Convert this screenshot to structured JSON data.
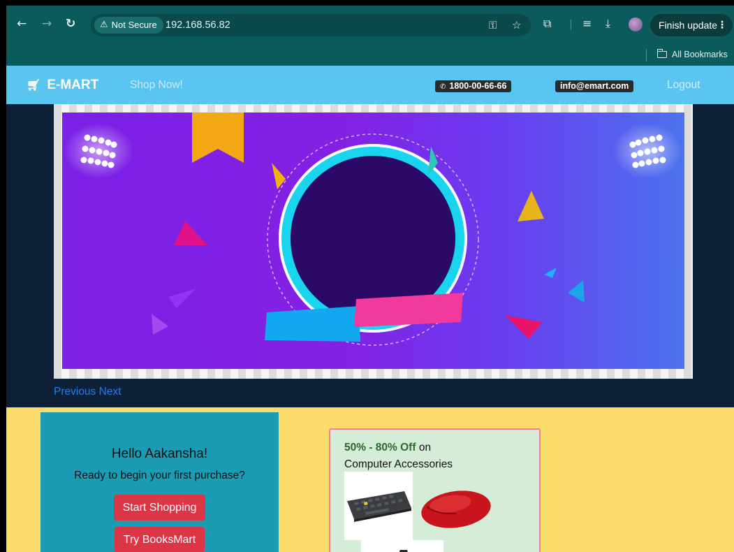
{
  "browser": {
    "security_label": "Not Secure",
    "url": "192.168.56.82",
    "finish_update_label": "Finish update",
    "bookmarks_label": "All Bookmarks"
  },
  "navbar": {
    "brand": "E-MART",
    "shop_link": "Shop Now!",
    "phone": "1800-00-66-66",
    "email": "info@emart.com",
    "logout": "Logout"
  },
  "carousel": {
    "previous": "Previous",
    "next": "Next"
  },
  "welcome": {
    "title": "Hello Aakansha!",
    "subtitle": "Ready to begin your first purchase?",
    "start_shopping": "Start Shopping",
    "try_booksmart": "Try BooksMart"
  },
  "offer": {
    "discount": "50% - 80% Off",
    "on": "on",
    "category": "Computer Accessories"
  },
  "colors": {
    "browser_bar": "#0b5b5d",
    "navbar": "#5bc5f2",
    "hero_bg": "#0e2038",
    "promo_bg": "#fbdb6a",
    "welcome_card": "#1a9cb4",
    "button_red": "#dc3545",
    "offer_card": "#d5ecd8"
  }
}
